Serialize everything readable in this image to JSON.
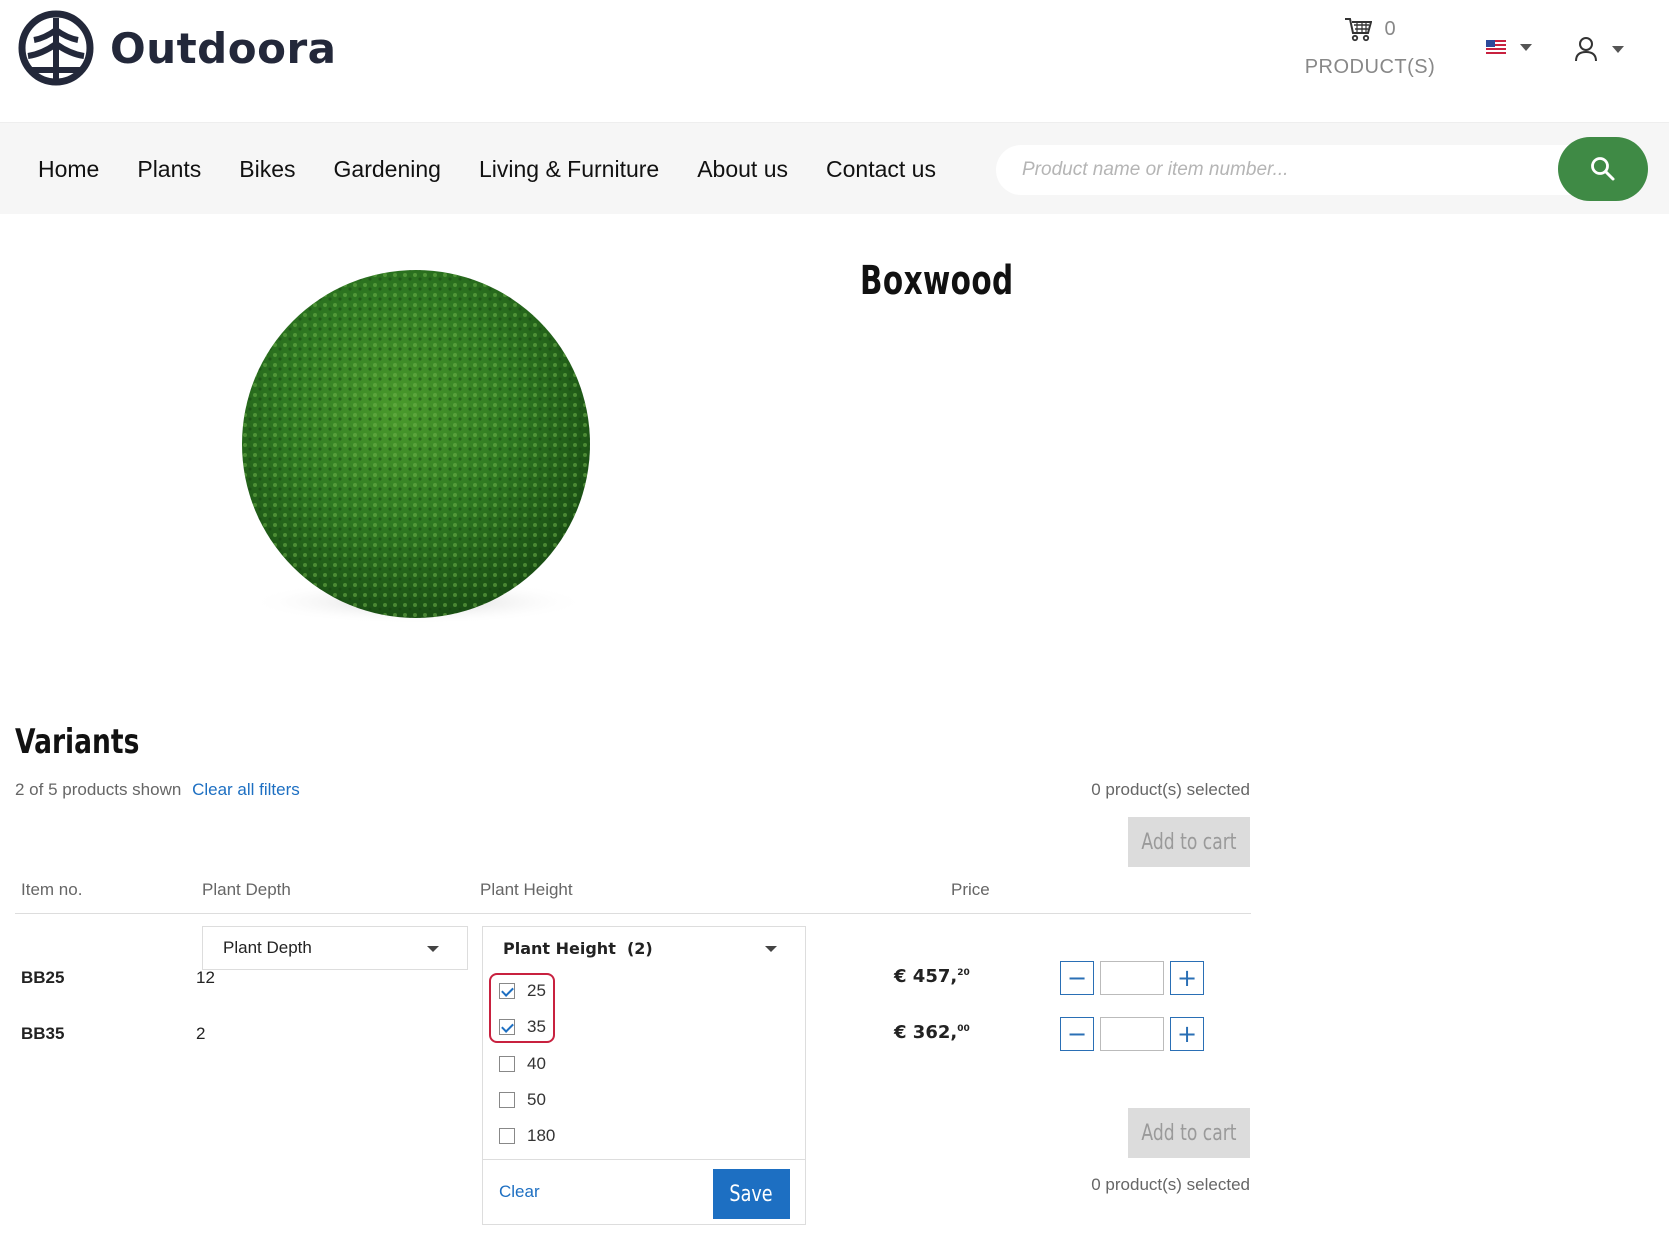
{
  "brand": {
    "name": "Outdoora"
  },
  "cart": {
    "count": "0",
    "label": "PRODUCT(S)"
  },
  "nav": {
    "items": [
      "Home",
      "Plants",
      "Bikes",
      "Gardening",
      "Living & Furniture",
      "About us",
      "Contact us"
    ]
  },
  "search": {
    "placeholder": "Product name or item number..."
  },
  "product": {
    "title": "Boxwood"
  },
  "variants": {
    "title": "Variants",
    "shown_text": "2 of 5 products shown",
    "clear_all": "Clear all filters",
    "selected_text": "0 product(s) selected",
    "add_to_cart": "Add to cart",
    "columns": [
      "Item no.",
      "Plant Depth",
      "Plant Height",
      "Price"
    ],
    "filter_depth_label": "Plant Depth",
    "filter_height_label": "Plant Height  (2)",
    "height_options": [
      {
        "label": "25",
        "checked": true
      },
      {
        "label": "35",
        "checked": true
      },
      {
        "label": "40",
        "checked": false
      },
      {
        "label": "50",
        "checked": false
      },
      {
        "label": "180",
        "checked": false
      }
    ],
    "dropdown_clear": "Clear",
    "dropdown_save": "Save",
    "rows": [
      {
        "item": "BB25",
        "depth": "12",
        "price_main": "€ 457,",
        "price_cents": "20"
      },
      {
        "item": "BB35",
        "depth": "2",
        "price_main": "€ 362,",
        "price_cents": "00"
      }
    ]
  },
  "colors": {
    "accent": "#1d6fc2",
    "search_button": "#3f8a45",
    "highlight": "#c8213f"
  }
}
